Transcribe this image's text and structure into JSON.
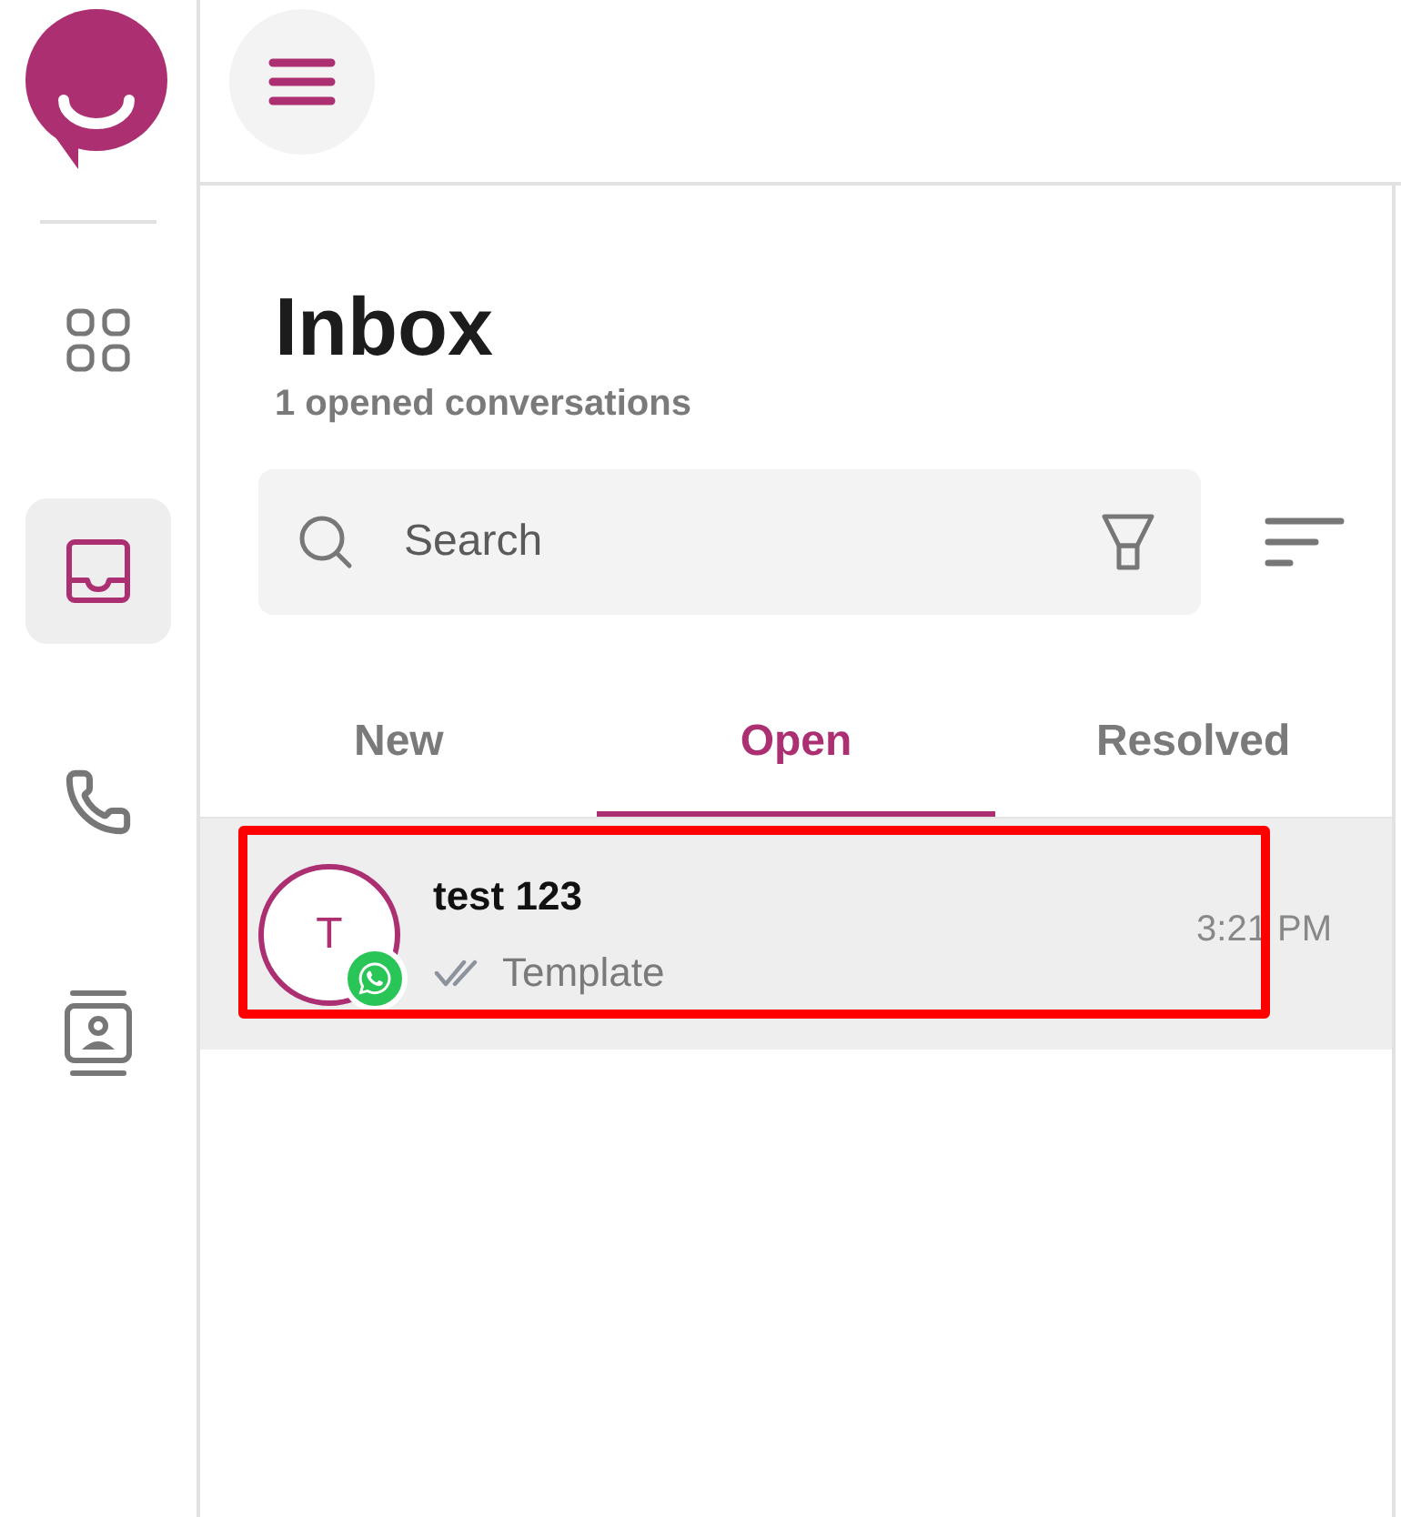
{
  "sidebar": {
    "items": [
      {
        "selected": false
      },
      {
        "selected": true
      },
      {
        "selected": false
      },
      {
        "selected": false
      }
    ]
  },
  "inbox": {
    "title": "Inbox",
    "subtitle": "1 opened conversations",
    "search": {
      "placeholder": "Search"
    }
  },
  "tabs": [
    {
      "label": "New",
      "selected": false
    },
    {
      "label": "Open",
      "selected": true
    },
    {
      "label": "Resolved",
      "selected": false
    }
  ],
  "conversations": [
    {
      "initial": "T",
      "name": "test 123",
      "preview": "Template",
      "time": "3:21 PM",
      "selected": true,
      "highlighted": true
    }
  ]
}
